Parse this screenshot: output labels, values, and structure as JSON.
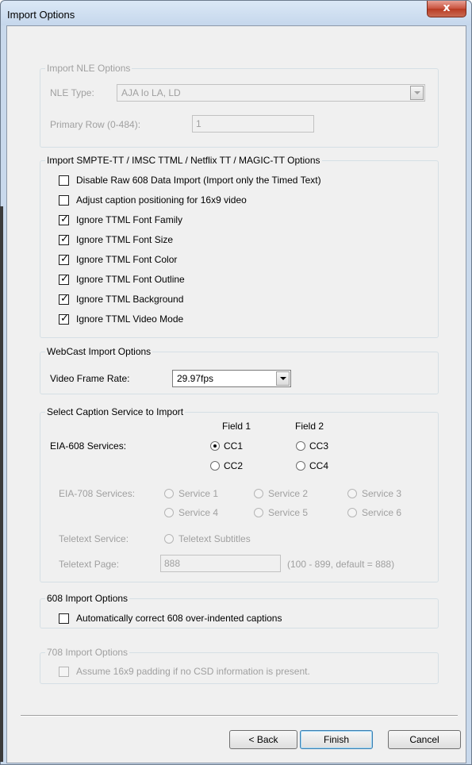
{
  "window": {
    "title": "Import Options",
    "close_glyph": "x"
  },
  "nle_group": {
    "legend": "Import NLE Options",
    "type_label": "NLE Type:",
    "type_value": "AJA Io LA, LD",
    "row_label": "Primary Row (0-484):",
    "row_value": "1"
  },
  "smpte_group": {
    "legend": "Import SMPTE-TT / IMSC TTML / Netflix TT / MAGIC-TT Options",
    "options": [
      {
        "label": "Disable Raw 608 Data Import (Import only the Timed Text)",
        "checked": false
      },
      {
        "label": "Adjust caption positioning for 16x9 video",
        "checked": false
      },
      {
        "label": "Ignore TTML Font Family",
        "checked": true
      },
      {
        "label": "Ignore TTML Font Size",
        "checked": true
      },
      {
        "label": "Ignore TTML Font Color",
        "checked": true
      },
      {
        "label": "Ignore TTML Font Outline",
        "checked": true
      },
      {
        "label": "Ignore TTML Background",
        "checked": true
      },
      {
        "label": "Ignore TTML Video Mode",
        "checked": true
      }
    ]
  },
  "webcast_group": {
    "legend": "WebCast Import Options",
    "rate_label": "Video Frame Rate:",
    "rate_value": "29.97fps"
  },
  "caption_group": {
    "legend": "Select Caption Service to Import",
    "field1": "Field 1",
    "field2": "Field 2",
    "eia608_label": "EIA-608 Services:",
    "cc1": "CC1",
    "cc2": "CC2",
    "cc3": "CC3",
    "cc4": "CC4",
    "selected": "CC1",
    "eia708_label": "EIA-708 Services:",
    "services": [
      "Service 1",
      "Service 2",
      "Service 3",
      "Service 4",
      "Service 5",
      "Service 6"
    ],
    "teletext_label": "Teletext Service:",
    "teletext_option": "Teletext Subtitles",
    "page_label": "Teletext Page:",
    "page_value": "888",
    "page_hint": "(100 - 899, default = 888)"
  },
  "import608_group": {
    "legend": "608 Import Options",
    "option": "Automatically correct 608 over-indented captions",
    "checked": false
  },
  "import708_group": {
    "legend": "708 Import Options",
    "option": "Assume 16x9 padding if no CSD information is present.",
    "checked": false
  },
  "buttons": {
    "back": "< Back",
    "finish": "Finish",
    "cancel": "Cancel"
  },
  "check_glyph": "✓"
}
